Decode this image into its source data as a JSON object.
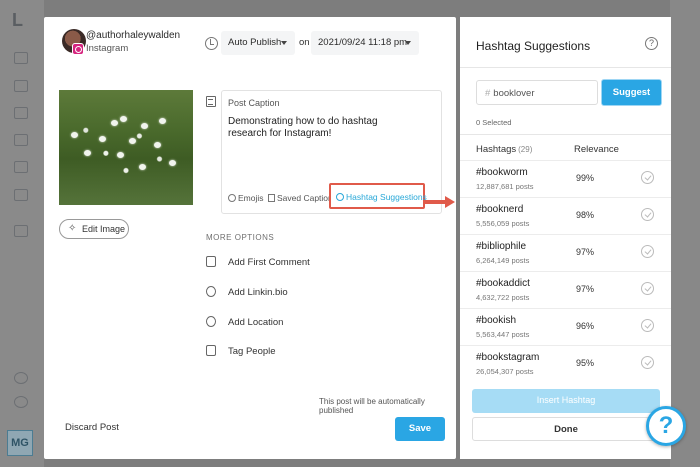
{
  "background_app": {
    "logo": "L",
    "workspace_initials": "MG"
  },
  "post": {
    "account_name": "@authorhaleywalden",
    "account_network": "Instagram",
    "publish_mode": "Auto Publish",
    "on_label": "on",
    "scheduled_datetime": "2021/09/24 11:18 pm",
    "edit_image_label": "Edit Image",
    "caption_title": "Post Caption",
    "caption_text": "Demonstrating how to do hashtag research for Instagram!",
    "caption_tools": {
      "emojis": "Emojis",
      "saved_captions": "Saved Captions",
      "hashtag_suggestions": "Hashtag Suggestions"
    },
    "more_options_label": "MORE OPTIONS",
    "options": [
      {
        "label": "Add First Comment",
        "icon": "comment-icon"
      },
      {
        "label": "Add Linkin.bio",
        "icon": "link-icon"
      },
      {
        "label": "Add Location",
        "icon": "location-pin-icon"
      },
      {
        "label": "Tag People",
        "icon": "person-tag-icon"
      }
    ],
    "auto_publish_note": "This post will be automatically published",
    "discard_label": "Discard Post",
    "save_label": "Save"
  },
  "hashtag_panel": {
    "title": "Hashtag Suggestions",
    "help_icon": "?",
    "search_prefix": "#",
    "search_value": "booklover",
    "suggest_label": "Suggest",
    "selected_count": "0 Selected",
    "col_hashtags": "Hashtags",
    "hashtag_count": "(29)",
    "col_relevance": "Relevance",
    "rows": [
      {
        "tag": "#bookworm",
        "posts": "12,887,681 posts",
        "relevance": "99%"
      },
      {
        "tag": "#booknerd",
        "posts": "5,556,059 posts",
        "relevance": "98%"
      },
      {
        "tag": "#bibliophile",
        "posts": "6,264,149 posts",
        "relevance": "97%"
      },
      {
        "tag": "#bookaddict",
        "posts": "4,632,722 posts",
        "relevance": "97%"
      },
      {
        "tag": "#bookish",
        "posts": "5,563,447 posts",
        "relevance": "96%"
      },
      {
        "tag": "#bookstagram",
        "posts": "26,054,307 posts",
        "relevance": "95%"
      }
    ],
    "insert_label": "Insert Hashtag",
    "done_label": "Done"
  },
  "help_bubble": "?",
  "colors": {
    "accent": "#2aa6e4",
    "highlight_annotation": "#e05a4a",
    "instagram_badge": "#d6257f"
  }
}
